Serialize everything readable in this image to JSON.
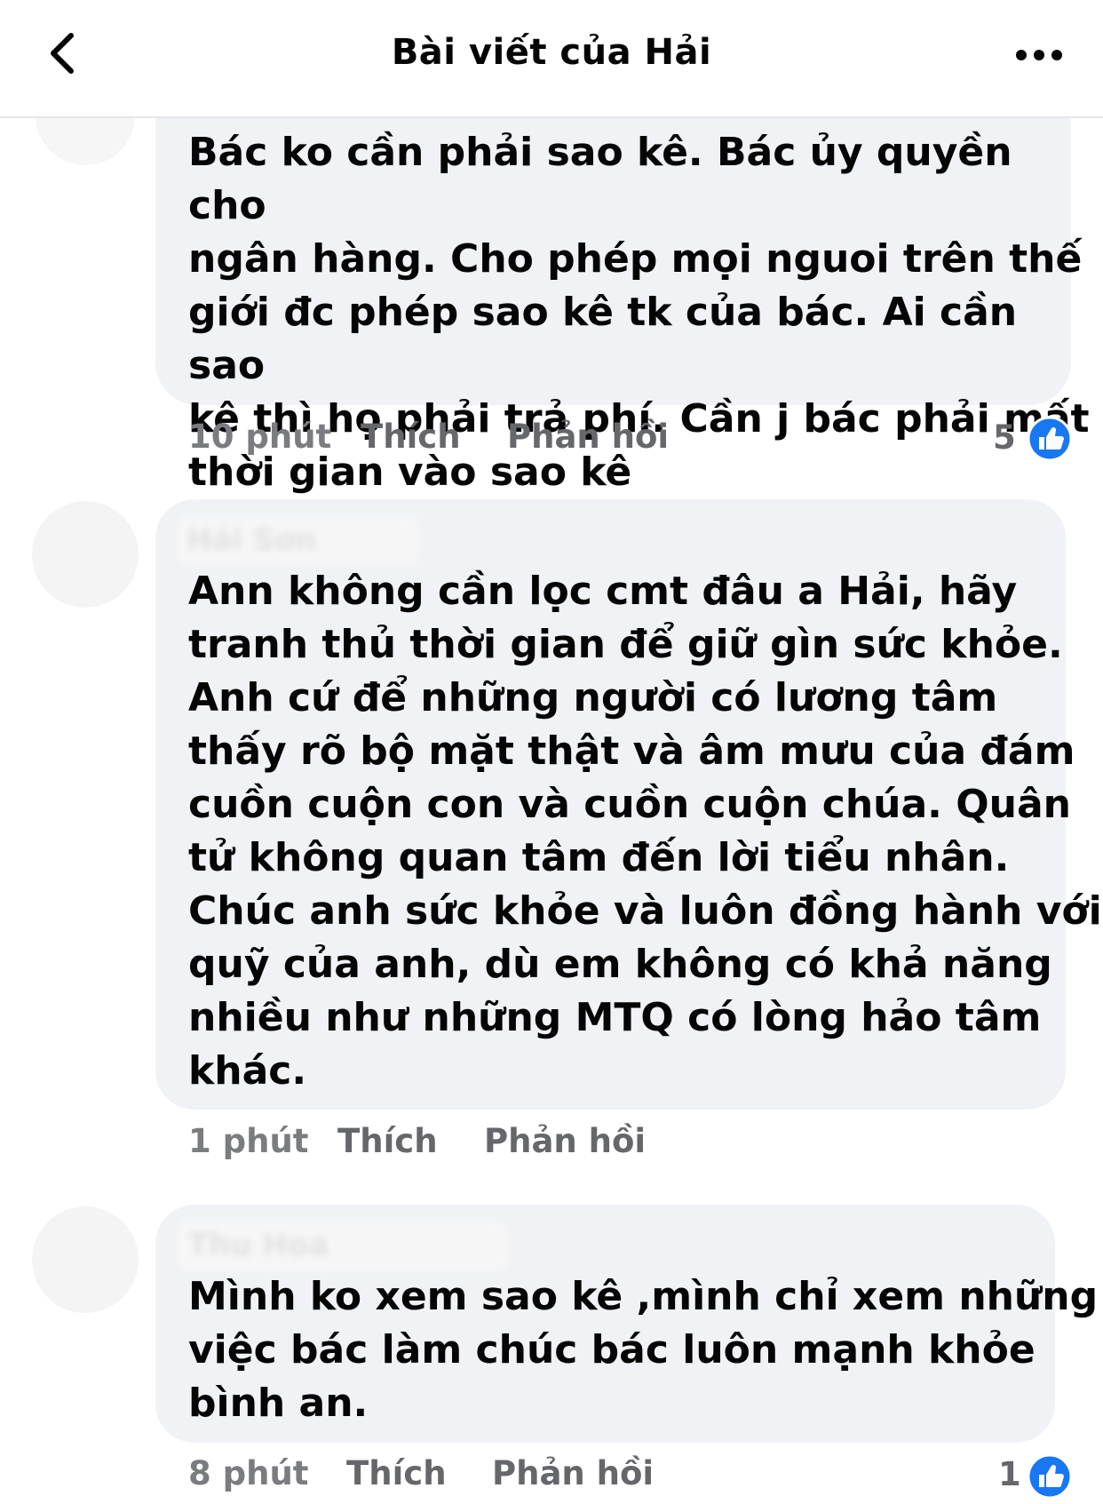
{
  "header": {
    "title": "Bài viết của Hải"
  },
  "comments": [
    {
      "text": "Bác ko cần phải sao kê. Bác ủy quyền cho\nngân hàng. Cho phép mọi nguoi trên thế\ngiới đc phép sao kê tk của bác. Ai cần sao\nkê thì họ phải trả phí. Cần j bác phải mất\nthời gian vào sao kê",
      "time": "10 phút",
      "like_label": "Thích",
      "reply_label": "Phản hồi",
      "reaction_count": "5"
    },
    {
      "author": "Hải Sơn",
      "text": "Ann không cần lọc cmt đâu a Hải, hãy\ntranh thủ thời gian để giữ gìn sức khỏe.\nAnh cứ để những người có lương tâm\nthấy rõ bộ mặt thật và âm mưu của đám\ncuồn cuộn con và cuồn cuộn chúa. Quân\ntử không quan tâm đến lời tiểu nhân.\nChúc anh sức khỏe và luôn đồng hành với\nquỹ của anh, dù em không có khả năng\nnhiều như những MTQ có lòng hảo tâm\nkhác.",
      "time": "1 phút",
      "like_label": "Thích",
      "reply_label": "Phản hồi"
    },
    {
      "author": "Thu Hoa",
      "text": "Mình ko xem sao kê ,mình chỉ xem những\nviệc bác làm chúc bác luôn mạnh khỏe\nbình an.",
      "time": "8 phút",
      "like_label": "Thích",
      "reply_label": "Phản hồi",
      "reaction_count": "1"
    }
  ],
  "colors": {
    "bubble": "#f0f2f5",
    "like_blue": "#1877f2",
    "meta_gray": "#65676b"
  },
  "icons": [
    "back-chevron-icon",
    "more-options-icon",
    "like-thumb-icon"
  ]
}
